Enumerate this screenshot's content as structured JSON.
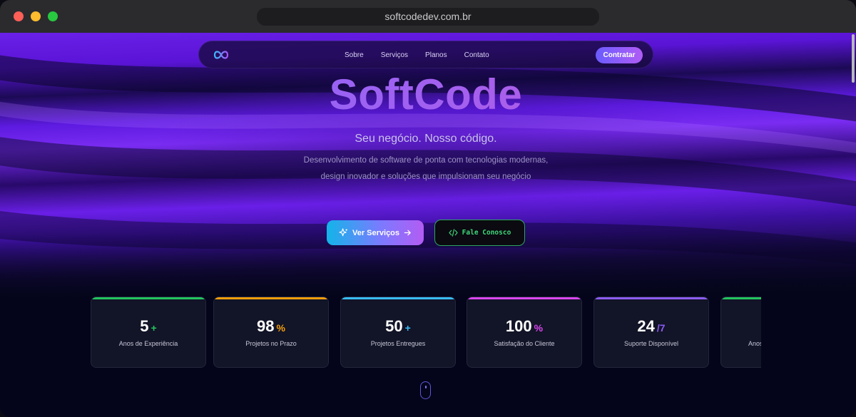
{
  "browser": {
    "url": "softcodedev.com.br"
  },
  "nav": {
    "links": [
      "Sobre",
      "Serviços",
      "Planos",
      "Contato"
    ],
    "cta_label": "Contratar"
  },
  "hero": {
    "brand": "SoftCode",
    "tagline": "Seu negócio. Nosso código.",
    "description": "Desenvolvimento de software de ponta com tecnologias modernas, design inovador e soluções que impulsionam seu negócio",
    "primary_button": "Ver Serviços",
    "secondary_button": "Fale Conosco"
  },
  "stats": [
    {
      "value": "5",
      "suffix": "+",
      "label": "Anos de Experiência",
      "accent": "#22c55e"
    },
    {
      "value": "98",
      "suffix": "%",
      "label": "Projetos no Prazo",
      "accent": "#f59e0b"
    },
    {
      "value": "50",
      "suffix": "+",
      "label": "Projetos Entregues",
      "accent": "#38bdf8"
    },
    {
      "value": "100",
      "suffix": "%",
      "label": "Satisfação do Cliente",
      "accent": "#d946ef"
    },
    {
      "value": "24",
      "suffix": "/7",
      "label": "Suporte Disponível",
      "accent": "#8b5cf6"
    },
    {
      "value": "",
      "suffix": "",
      "label": "Anos",
      "accent": "#22c55e"
    }
  ],
  "colors": {
    "hero_purple": "#6a20e8",
    "page_background": "#04051a",
    "card_background": "#121427",
    "secondary_button_accent": "#3fd77a"
  }
}
